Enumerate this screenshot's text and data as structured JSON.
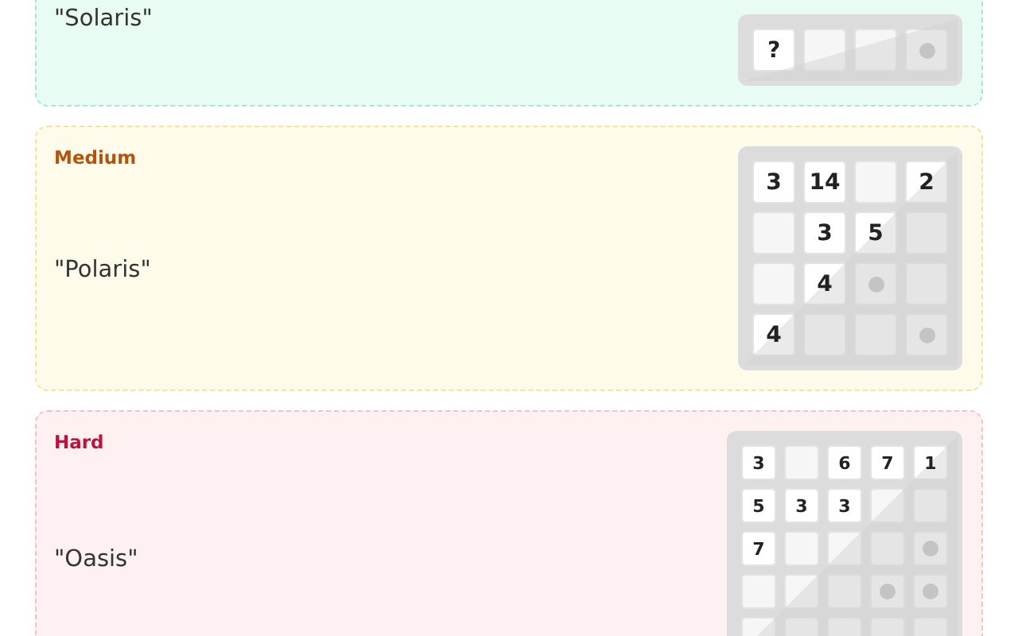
{
  "puzzles": [
    {
      "kind": "easy",
      "name": "\"Solaris\"",
      "grid": [
        [
          {
            "kind": "number",
            "value": "?"
          },
          {
            "kind": "empty"
          },
          {
            "kind": "empty"
          },
          {
            "kind": "dot"
          }
        ]
      ]
    },
    {
      "kind": "medium",
      "difficulty": "Medium",
      "name": "\"Polaris\"",
      "grid": [
        [
          {
            "kind": "number",
            "value": "3"
          },
          {
            "kind": "number",
            "value": "14"
          },
          {
            "kind": "empty"
          },
          {
            "kind": "number",
            "value": "2"
          }
        ],
        [
          {
            "kind": "empty"
          },
          {
            "kind": "number",
            "value": "3"
          },
          {
            "kind": "number",
            "value": "5"
          },
          {
            "kind": "empty"
          }
        ],
        [
          {
            "kind": "empty"
          },
          {
            "kind": "number",
            "value": "4"
          },
          {
            "kind": "dot"
          },
          {
            "kind": "empty"
          }
        ],
        [
          {
            "kind": "number",
            "value": "4"
          },
          {
            "kind": "empty"
          },
          {
            "kind": "empty"
          },
          {
            "kind": "dot"
          }
        ]
      ]
    },
    {
      "kind": "hard",
      "difficulty": "Hard",
      "name": "\"Oasis\"",
      "grid": [
        [
          {
            "kind": "number",
            "value": "3"
          },
          {
            "kind": "empty"
          },
          {
            "kind": "number",
            "value": "6"
          },
          {
            "kind": "number",
            "value": "7"
          },
          {
            "kind": "number",
            "value": "1"
          }
        ],
        [
          {
            "kind": "number",
            "value": "5"
          },
          {
            "kind": "number",
            "value": "3"
          },
          {
            "kind": "number",
            "value": "3"
          },
          {
            "kind": "empty"
          },
          {
            "kind": "empty"
          }
        ],
        [
          {
            "kind": "number",
            "value": "7"
          },
          {
            "kind": "empty"
          },
          {
            "kind": "empty"
          },
          {
            "kind": "empty"
          },
          {
            "kind": "dot"
          }
        ],
        [
          {
            "kind": "empty"
          },
          {
            "kind": "empty"
          },
          {
            "kind": "empty"
          },
          {
            "kind": "dot"
          },
          {
            "kind": "dot"
          }
        ],
        [
          {
            "kind": "empty"
          },
          {
            "kind": "empty"
          },
          {
            "kind": "empty"
          },
          {
            "kind": "empty"
          },
          {
            "kind": "empty"
          }
        ]
      ]
    }
  ]
}
